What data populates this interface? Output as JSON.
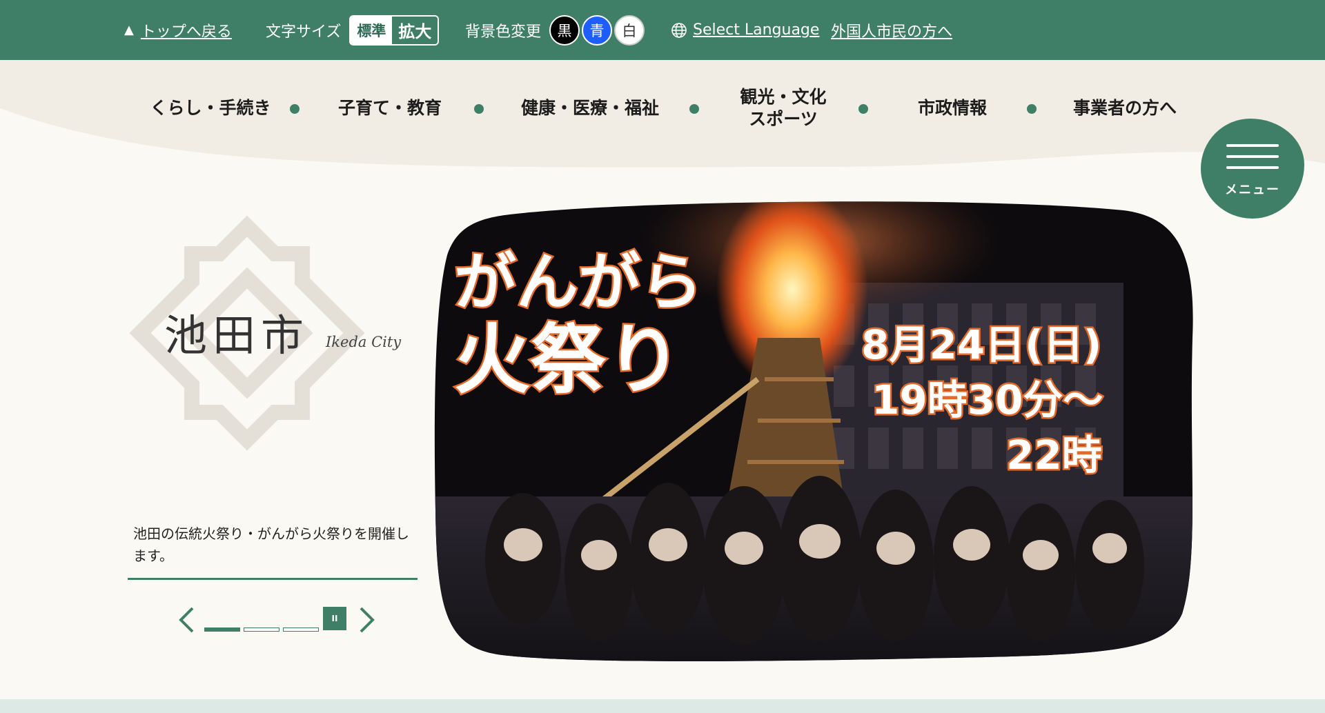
{
  "topbar": {
    "back_to_top": "トップへ戻る",
    "font_size_label": "文字サイズ",
    "font_size_standard": "標準",
    "font_size_large": "拡大",
    "bg_color_label": "背景色変更",
    "bg_black": "黒",
    "bg_blue": "青",
    "bg_white": "白",
    "select_language": "Select Language",
    "foreign_residents": "外国人市民の方へ"
  },
  "nav": {
    "items": [
      {
        "label": "くらし・手続き"
      },
      {
        "label": "子育て・教育"
      },
      {
        "label": "健康・医療・福祉"
      },
      {
        "label": "観光・文化\nスポーツ"
      },
      {
        "label": "市政情報"
      },
      {
        "label": "事業者の方へ"
      }
    ]
  },
  "menu": {
    "label": "メニュー"
  },
  "logo": {
    "name": "池田市",
    "sub": "Ikeda City"
  },
  "hero": {
    "caption": "池田の伝統火祭り・がんがら火祭りを開催します。",
    "title_line1": "がんがら",
    "title_line2": "火祭り",
    "date": "8月24日(日)",
    "time1": "19時30分〜",
    "time2": "22時",
    "slide_count": 3,
    "active_slide": 1,
    "pause_label": "II"
  },
  "colors": {
    "brand_green": "#3f7f67",
    "page_bg": "#fbf9f4"
  }
}
